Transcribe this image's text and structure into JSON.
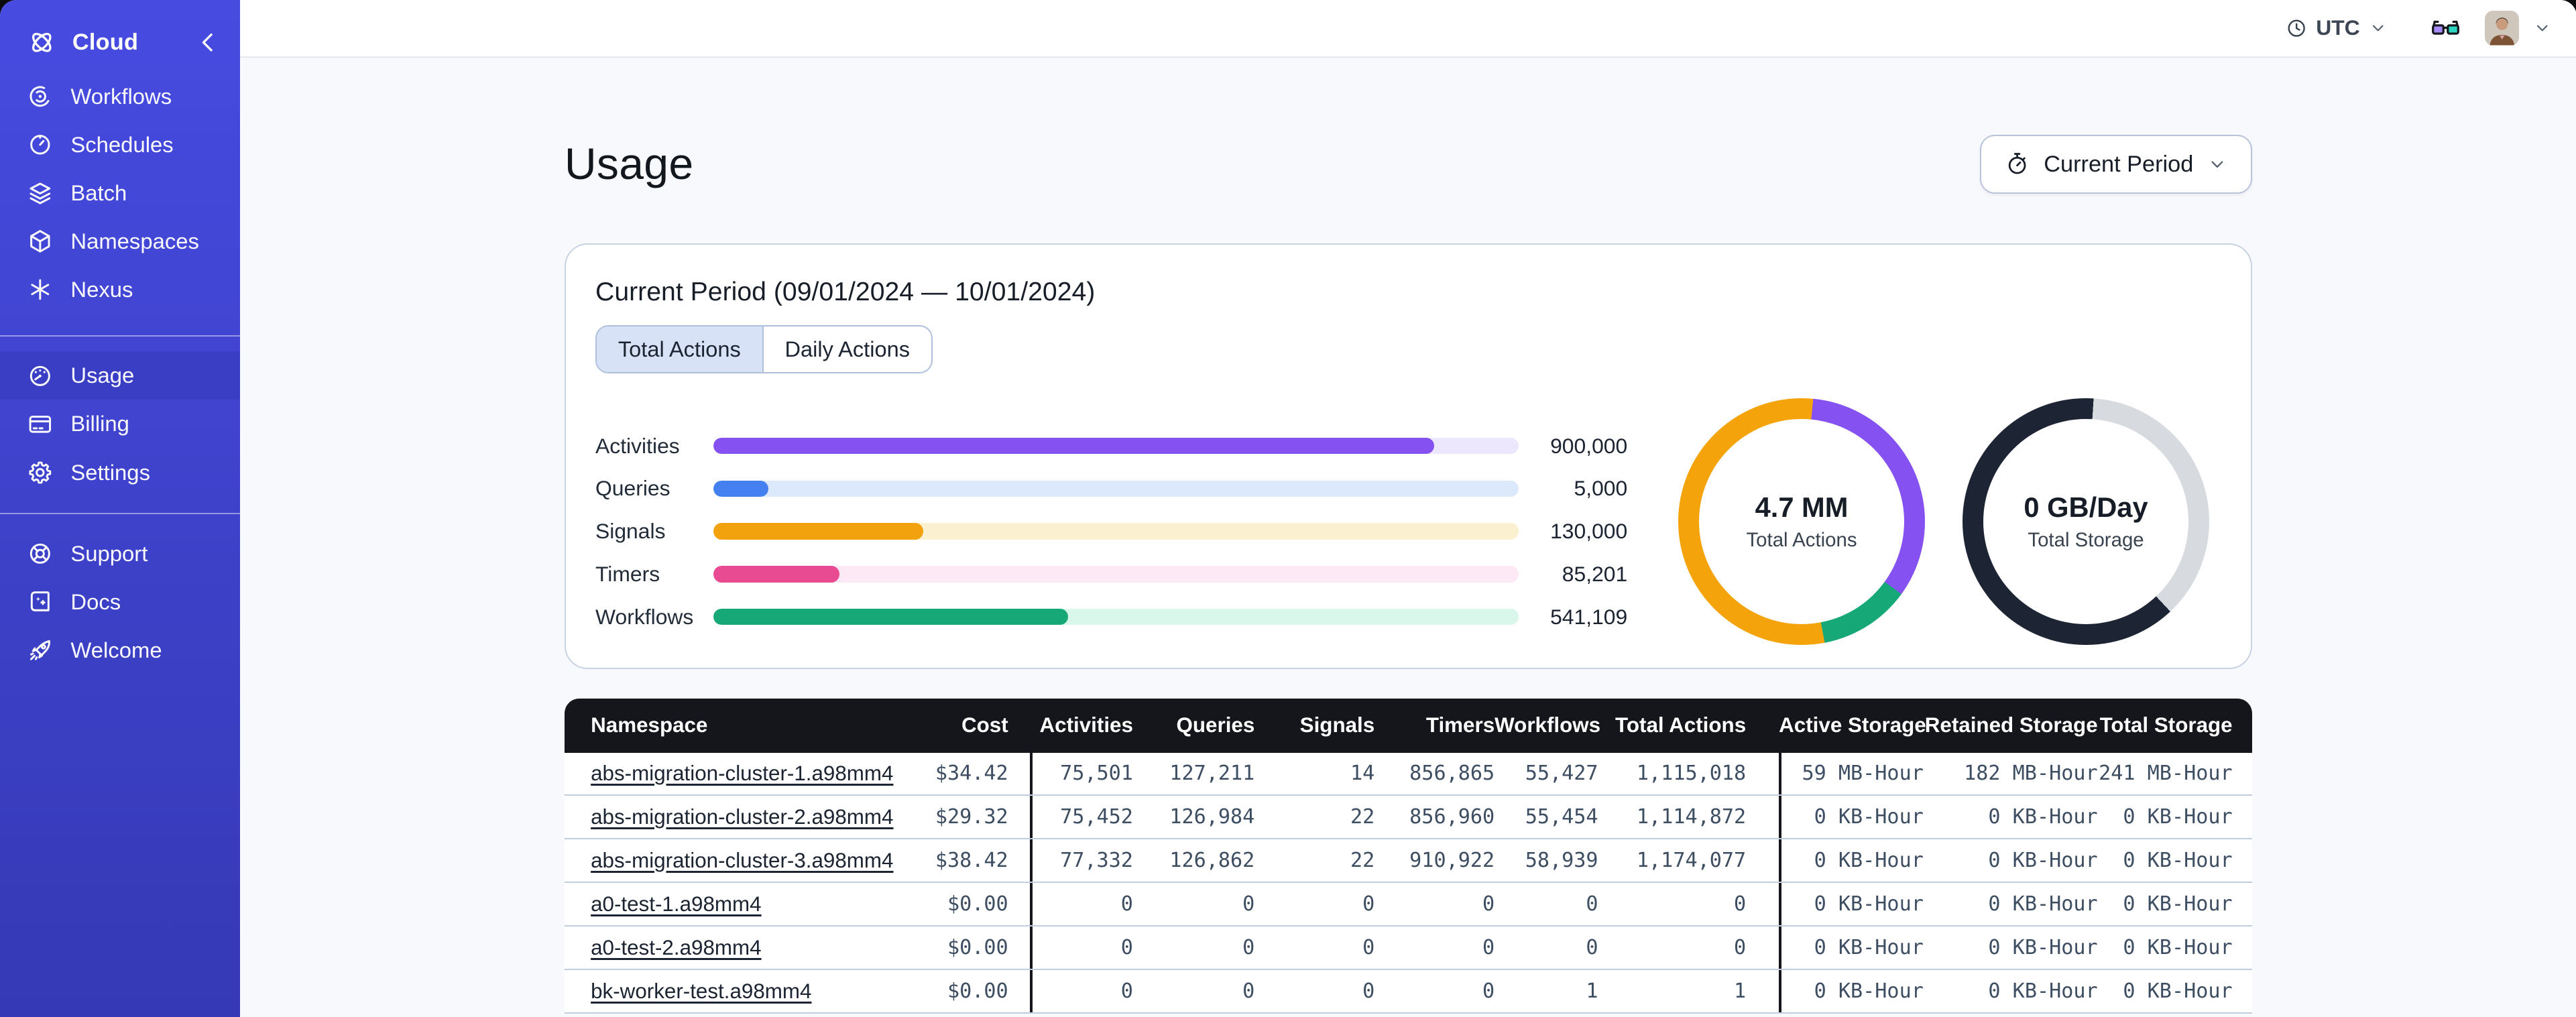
{
  "colors": {
    "sidebar_top": "#474be0",
    "sidebar_bottom": "#3539b5",
    "sidebar_active": "#3a3ec4",
    "table_header_bg": "#15161c",
    "card_border": "#c9d4e3"
  },
  "sidebar": {
    "brand": {
      "label": "Cloud",
      "icon": "temporal-logo"
    },
    "sections": [
      {
        "items": [
          {
            "id": "workflows",
            "icon": "workflows",
            "label": "Workflows"
          },
          {
            "id": "schedules",
            "icon": "schedules",
            "label": "Schedules"
          },
          {
            "id": "batch",
            "icon": "batch",
            "label": "Batch"
          },
          {
            "id": "namespaces",
            "icon": "namespaces",
            "label": "Namespaces"
          },
          {
            "id": "nexus",
            "icon": "nexus",
            "label": "Nexus"
          }
        ]
      },
      {
        "items": [
          {
            "id": "usage",
            "icon": "usage",
            "label": "Usage",
            "active": true
          },
          {
            "id": "billing",
            "icon": "billing",
            "label": "Billing"
          },
          {
            "id": "settings",
            "icon": "settings",
            "label": "Settings"
          }
        ]
      },
      {
        "items": [
          {
            "id": "support",
            "icon": "support",
            "label": "Support"
          },
          {
            "id": "docs",
            "icon": "docs",
            "label": "Docs"
          },
          {
            "id": "welcome",
            "icon": "welcome",
            "label": "Welcome"
          }
        ]
      }
    ]
  },
  "topbar": {
    "timezone": "UTC"
  },
  "page": {
    "title": "Usage",
    "period_button_label": "Current Period"
  },
  "usage_card": {
    "title": "Current Period (09/01/2024 — 10/01/2024)",
    "tabs": [
      {
        "label": "Total Actions",
        "active": true
      },
      {
        "label": "Daily Actions",
        "active": false
      }
    ]
  },
  "chart_data": [
    {
      "type": "bar",
      "orientation": "horizontal",
      "categories": [
        "Activities",
        "Queries",
        "Signals",
        "Timers",
        "Workflows"
      ],
      "values": [
        900000,
        5000,
        130000,
        85201,
        541109
      ],
      "value_labels": [
        "900,000",
        "5,000",
        "130,000",
        "85,201",
        "541,109"
      ],
      "percent_filled": [
        89.5,
        6.8,
        26,
        15.6,
        44
      ],
      "bar_colors": [
        "#8551f1",
        "#4480f0",
        "#f2a20c",
        "#e94b92",
        "#16a877"
      ],
      "track_colors": [
        "#ece7fc",
        "#dce9fc",
        "#fbf0cf",
        "#fde9f6",
        "#d8f6e9"
      ]
    },
    {
      "type": "pie",
      "center_value": "4.7 MM",
      "center_label": "Total Actions",
      "segments": [
        {
          "color": "#f4a40a",
          "pct": 1.5
        },
        {
          "color": "#8551f1",
          "pct": 33.5
        },
        {
          "color": "#16a877",
          "pct": 12
        },
        {
          "color": "#f4a40a",
          "pct": 53
        }
      ]
    },
    {
      "type": "pie",
      "center_value": "0 GB/Day",
      "center_label": "Total Storage",
      "segments": [
        {
          "color": "#1d2534",
          "pct": 1
        },
        {
          "color": "#d7dbe0",
          "pct": 37
        },
        {
          "color": "#1d2534",
          "pct": 62
        }
      ]
    }
  ],
  "table": {
    "headers": [
      "Namespace",
      "Cost",
      "Activities",
      "Queries",
      "Signals",
      "Timers",
      "Workflows",
      "Total Actions",
      "Active Storage",
      "Retained Storage",
      "Total Storage"
    ],
    "rows": [
      {
        "namespace": "abs-migration-cluster-1.a98mm4",
        "cost": "$34.42",
        "activities": "75,501",
        "queries": "127,211",
        "signals": "14",
        "timers": "856,865",
        "workflows": "55,427",
        "total_actions": "1,115,018",
        "active_storage": "59 MB-Hour",
        "retained_storage": "182 MB-Hour",
        "total_storage": "241 MB-Hour"
      },
      {
        "namespace": "abs-migration-cluster-2.a98mm4",
        "cost": "$29.32",
        "activities": "75,452",
        "queries": "126,984",
        "signals": "22",
        "timers": "856,960",
        "workflows": "55,454",
        "total_actions": "1,114,872",
        "active_storage": "0 KB-Hour",
        "retained_storage": "0 KB-Hour",
        "total_storage": "0 KB-Hour"
      },
      {
        "namespace": "abs-migration-cluster-3.a98mm4",
        "cost": "$38.42",
        "activities": "77,332",
        "queries": "126,862",
        "signals": "22",
        "timers": "910,922",
        "workflows": "58,939",
        "total_actions": "1,174,077",
        "active_storage": "0 KB-Hour",
        "retained_storage": "0 KB-Hour",
        "total_storage": "0 KB-Hour"
      },
      {
        "namespace": "a0-test-1.a98mm4",
        "cost": "$0.00",
        "activities": "0",
        "queries": "0",
        "signals": "0",
        "timers": "0",
        "workflows": "0",
        "total_actions": "0",
        "active_storage": "0 KB-Hour",
        "retained_storage": "0 KB-Hour",
        "total_storage": "0 KB-Hour"
      },
      {
        "namespace": "a0-test-2.a98mm4",
        "cost": "$0.00",
        "activities": "0",
        "queries": "0",
        "signals": "0",
        "timers": "0",
        "workflows": "0",
        "total_actions": "0",
        "active_storage": "0 KB-Hour",
        "retained_storage": "0 KB-Hour",
        "total_storage": "0 KB-Hour"
      },
      {
        "namespace": "bk-worker-test.a98mm4",
        "cost": "$0.00",
        "activities": "0",
        "queries": "0",
        "signals": "0",
        "timers": "0",
        "workflows": "1",
        "total_actions": "1",
        "active_storage": "0 KB-Hour",
        "retained_storage": "0 KB-Hour",
        "total_storage": "0 KB-Hour"
      }
    ]
  }
}
